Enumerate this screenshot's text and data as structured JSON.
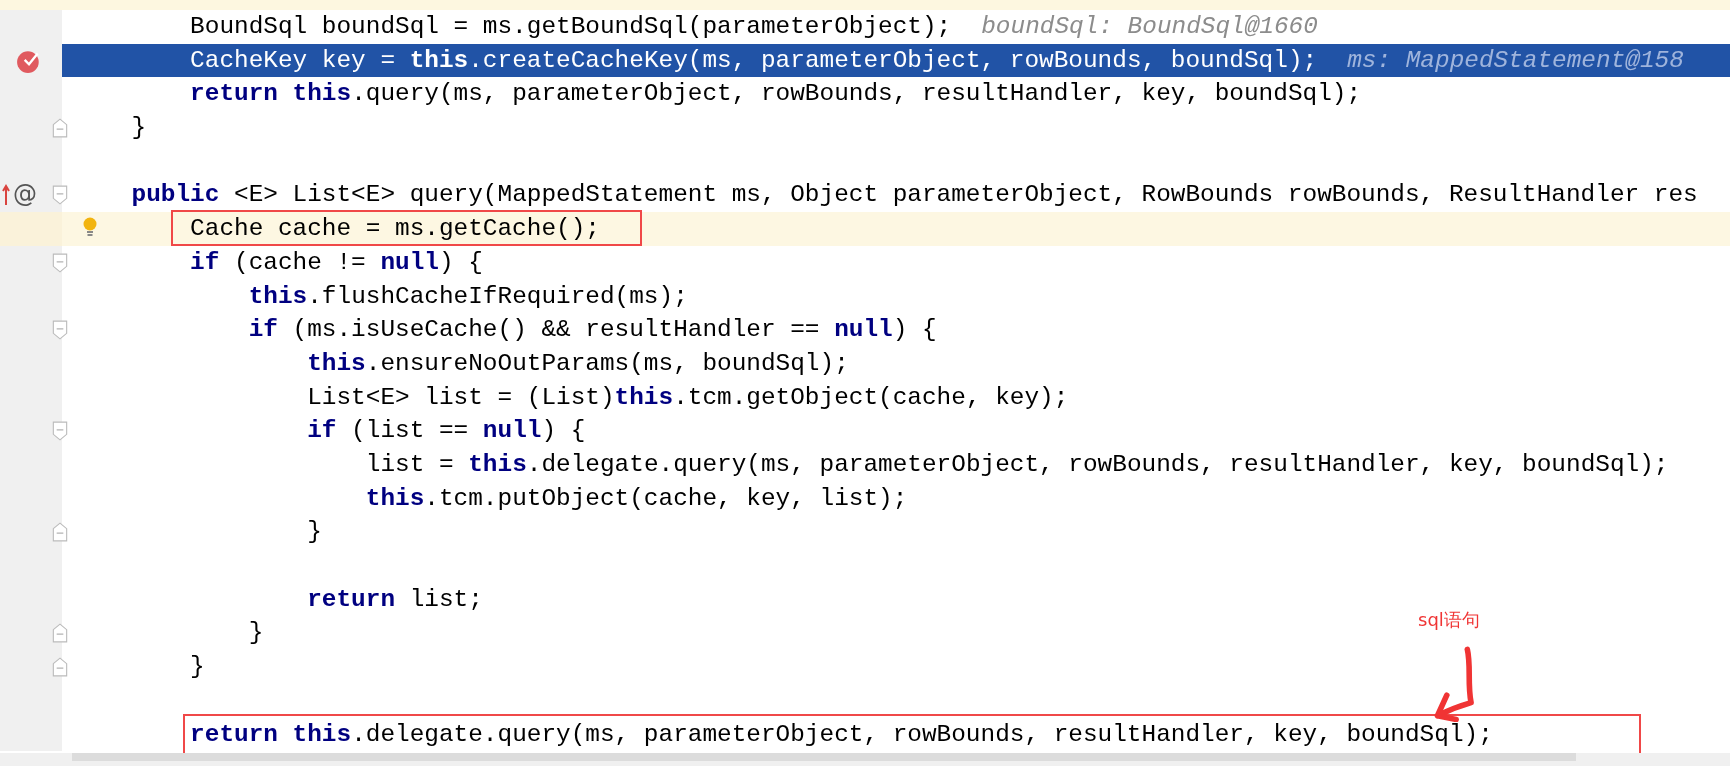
{
  "editor": {
    "lines": [
      {
        "kind": "code",
        "selected": false,
        "caret": false,
        "boxed": false,
        "segments": [
          {
            "text": "        BoundSql boundSql = ms.getBoundSql(parameterObject);",
            "kind": "plain"
          }
        ],
        "hint": "boundSql: BoundSql@1660"
      },
      {
        "kind": "code",
        "selected": true,
        "caret": false,
        "boxed": false,
        "gutter": [
          {
            "kind": "breakpoint"
          }
        ],
        "segments": [
          {
            "text": "        CacheKey key = ",
            "kind": "plain"
          },
          {
            "text": "this",
            "kind": "keyword"
          },
          {
            "text": ".createCacheKey(ms, parameterObject, rowBounds, boundSql);",
            "kind": "plain"
          }
        ],
        "hint": "ms: MappedStatement@158"
      },
      {
        "kind": "code",
        "selected": false,
        "caret": false,
        "boxed": false,
        "segments": [
          {
            "text": "        return",
            "kind": "keyword"
          },
          {
            "text": " this",
            "kind": "keyword"
          },
          {
            "text": ".query(ms, parameterObject, rowBounds, resultHandler, key, boundSql);",
            "kind": "plain"
          }
        ]
      },
      {
        "kind": "code",
        "selected": false,
        "caret": false,
        "boxed": false,
        "gutter": [
          {
            "kind": "fold-end"
          }
        ],
        "segments": [
          {
            "text": "    }",
            "kind": "plain"
          }
        ]
      },
      {
        "kind": "blank"
      },
      {
        "kind": "code",
        "selected": false,
        "caret": false,
        "boxed": false,
        "gutter": [
          {
            "kind": "override"
          },
          {
            "kind": "annotation",
            "text": "@"
          },
          {
            "kind": "fold-start"
          }
        ],
        "segments": [
          {
            "text": "    public",
            "kind": "keyword"
          },
          {
            "text": " <E> List<E> query(MappedStatement ms, Object parameterObject, RowBounds rowBounds, ResultHandler res",
            "kind": "plain"
          }
        ]
      },
      {
        "kind": "code",
        "selected": false,
        "caret": true,
        "boxed": true,
        "gutter": [
          {
            "kind": "bulb"
          }
        ],
        "segments": [
          {
            "text": "        Cache cache = ms.getCache();",
            "kind": "plain"
          }
        ]
      },
      {
        "kind": "code",
        "selected": false,
        "caret": false,
        "boxed": false,
        "gutter": [
          {
            "kind": "fold-start"
          }
        ],
        "segments": [
          {
            "text": "        if",
            "kind": "keyword"
          },
          {
            "text": " (cache != ",
            "kind": "plain"
          },
          {
            "text": "null",
            "kind": "keyword"
          },
          {
            "text": ") {",
            "kind": "plain"
          }
        ]
      },
      {
        "kind": "code",
        "selected": false,
        "caret": false,
        "boxed": false,
        "segments": [
          {
            "text": "            this",
            "kind": "keyword"
          },
          {
            "text": ".flushCacheIfRequired(ms);",
            "kind": "plain"
          }
        ]
      },
      {
        "kind": "code",
        "selected": false,
        "caret": false,
        "boxed": false,
        "gutter": [
          {
            "kind": "fold-start"
          }
        ],
        "segments": [
          {
            "text": "            if",
            "kind": "keyword"
          },
          {
            "text": " (ms.isUseCache() && resultHandler == ",
            "kind": "plain"
          },
          {
            "text": "null",
            "kind": "keyword"
          },
          {
            "text": ") {",
            "kind": "plain"
          }
        ]
      },
      {
        "kind": "code",
        "selected": false,
        "caret": false,
        "boxed": false,
        "segments": [
          {
            "text": "                this",
            "kind": "keyword"
          },
          {
            "text": ".ensureNoOutParams(ms, boundSql);",
            "kind": "plain"
          }
        ]
      },
      {
        "kind": "code",
        "selected": false,
        "caret": false,
        "boxed": false,
        "segments": [
          {
            "text": "                List<E> list = (List)",
            "kind": "plain"
          },
          {
            "text": "this",
            "kind": "keyword"
          },
          {
            "text": ".tcm.getObject(cache, key);",
            "kind": "plain"
          }
        ]
      },
      {
        "kind": "code",
        "selected": false,
        "caret": false,
        "boxed": false,
        "gutter": [
          {
            "kind": "fold-start"
          }
        ],
        "segments": [
          {
            "text": "                if",
            "kind": "keyword"
          },
          {
            "text": " (list == ",
            "kind": "plain"
          },
          {
            "text": "null",
            "kind": "keyword"
          },
          {
            "text": ") {",
            "kind": "plain"
          }
        ]
      },
      {
        "kind": "code",
        "selected": false,
        "caret": false,
        "boxed": false,
        "segments": [
          {
            "text": "                    list = ",
            "kind": "plain"
          },
          {
            "text": "this",
            "kind": "keyword"
          },
          {
            "text": ".delegate.query(ms, parameterObject, rowBounds, resultHandler, key, boundSql);",
            "kind": "plain"
          }
        ]
      },
      {
        "kind": "code",
        "selected": false,
        "caret": false,
        "boxed": false,
        "segments": [
          {
            "text": "                    this",
            "kind": "keyword"
          },
          {
            "text": ".tcm.putObject(cache, key, list);",
            "kind": "plain"
          }
        ]
      },
      {
        "kind": "code",
        "selected": false,
        "caret": false,
        "boxed": false,
        "gutter": [
          {
            "kind": "fold-end"
          }
        ],
        "segments": [
          {
            "text": "                }",
            "kind": "plain"
          }
        ]
      },
      {
        "kind": "blank"
      },
      {
        "kind": "code",
        "selected": false,
        "caret": false,
        "boxed": false,
        "segments": [
          {
            "text": "                return",
            "kind": "keyword"
          },
          {
            "text": " list;",
            "kind": "plain"
          }
        ]
      },
      {
        "kind": "code",
        "selected": false,
        "caret": false,
        "boxed": false,
        "gutter": [
          {
            "kind": "fold-end"
          }
        ],
        "segments": [
          {
            "text": "            }",
            "kind": "plain"
          }
        ]
      },
      {
        "kind": "code",
        "selected": false,
        "caret": false,
        "boxed": false,
        "gutter": [
          {
            "kind": "fold-end"
          }
        ],
        "segments": [
          {
            "text": "        }",
            "kind": "plain"
          }
        ]
      },
      {
        "kind": "blank"
      },
      {
        "kind": "code",
        "selected": false,
        "caret": false,
        "boxed": true,
        "segments": [
          {
            "text": "        return",
            "kind": "keyword"
          },
          {
            "text": " this",
            "kind": "keyword"
          },
          {
            "text": ".delegate.query(ms, parameterObject, rowBounds, resultHandler, key, boundSql);",
            "kind": "plain"
          }
        ]
      }
    ]
  },
  "annotation": {
    "label": "sql语句"
  }
}
